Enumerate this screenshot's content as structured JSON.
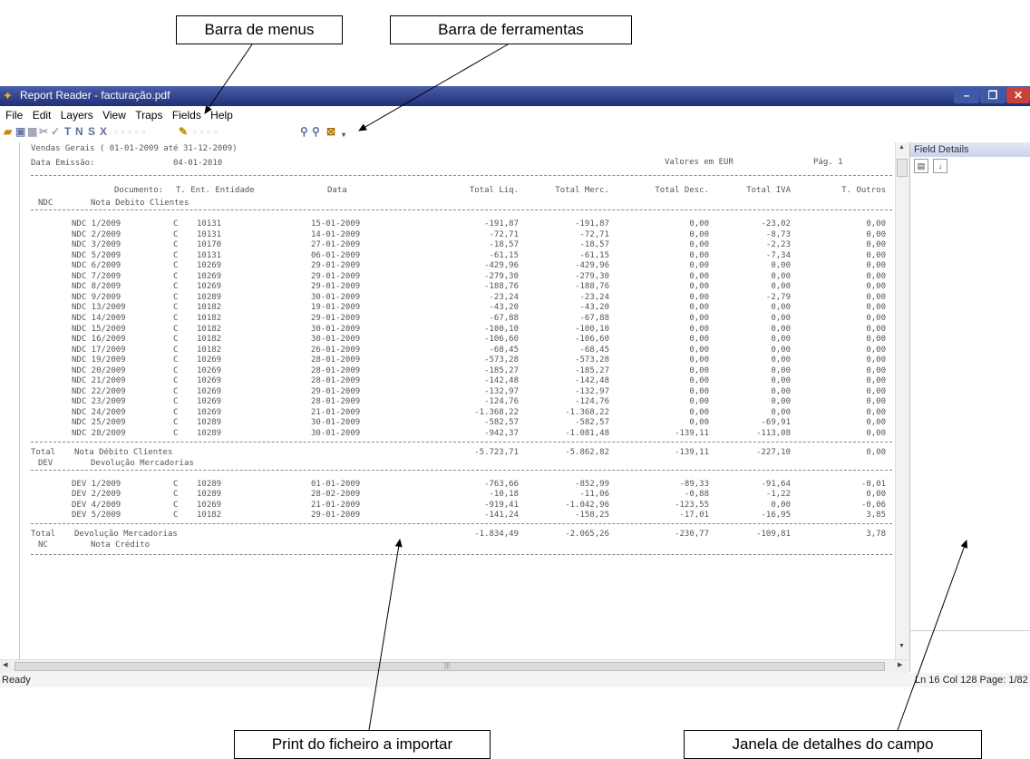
{
  "callouts": {
    "menu_bar": "Barra de menus",
    "toolbar": "Barra de ferramentas",
    "print_file": "Print do ficheiro a importar",
    "field_details_window": "Janela de detalhes do campo"
  },
  "window": {
    "title": "Report Reader - facturação.pdf",
    "controls": {
      "minimize": "–",
      "maximize": "❐",
      "close": "✕"
    }
  },
  "menu": [
    "File",
    "Edit",
    "Layers",
    "View",
    "Traps",
    "Fields",
    "Help"
  ],
  "toolbar": {
    "icons": [
      "open-icon",
      "save-icon",
      "trap-icon",
      "cut-icon",
      "check-icon",
      "text-trap-icon",
      "numeric-trap-icon",
      "string-trap-icon",
      "delete-icon",
      "zoom-in-icon",
      "zoom-out-icon",
      "fit-page-icon"
    ],
    "letters": [
      "T",
      "N",
      "S",
      "X"
    ]
  },
  "report": {
    "title": "Vendas Gerais ( 01-01-2009 até 31-12-2009)",
    "emission_label": "Data Emissão:",
    "emission_date": "04-01-2010",
    "currency_note": "Valores em EUR",
    "page_label": "Pág. 1",
    "headers": {
      "documento": "Documento:",
      "tipo_entidade": "T. Ent. Entidade",
      "data": "Data",
      "total_liq": "Total Liq.",
      "total_merc": "Total Merc.",
      "total_desc": "Total Desc.",
      "total_iva": "Total IVA",
      "total_outros": "T. Outros"
    },
    "groups": [
      {
        "code": "NDC",
        "name": "Nota Debito Clientes",
        "rows": [
          [
            "NDC 1/2009",
            "C",
            "10131",
            "15-01-2009",
            "-191,87",
            "-191,87",
            "0,00",
            "-23,02",
            "0,00"
          ],
          [
            "NDC 2/2009",
            "C",
            "10131",
            "14-01-2009",
            "-72,71",
            "-72,71",
            "0,00",
            "-8,73",
            "0,00"
          ],
          [
            "NDC 3/2009",
            "C",
            "10170",
            "27-01-2009",
            "-18,57",
            "-18,57",
            "0,00",
            "-2,23",
            "0,00"
          ],
          [
            "NDC 5/2009",
            "C",
            "10131",
            "06-01-2009",
            "-61,15",
            "-61,15",
            "0,00",
            "-7,34",
            "0,00"
          ],
          [
            "NDC 6/2009",
            "C",
            "10269",
            "29-01-2009",
            "-429,96",
            "-429,96",
            "0,00",
            "0,00",
            "0,00"
          ],
          [
            "NDC 7/2009",
            "C",
            "10269",
            "29-01-2009",
            "-279,30",
            "-279,30",
            "0,00",
            "0,00",
            "0,00"
          ],
          [
            "NDC 8/2009",
            "C",
            "10269",
            "29-01-2009",
            "-188,76",
            "-188,76",
            "0,00",
            "0,00",
            "0,00"
          ],
          [
            "NDC 9/2009",
            "C",
            "10289",
            "30-01-2009",
            "-23,24",
            "-23,24",
            "0,00",
            "-2,79",
            "0,00"
          ],
          [
            "NDC 13/2009",
            "C",
            "10182",
            "19-01-2009",
            "-43,20",
            "-43,20",
            "0,00",
            "0,00",
            "0,00"
          ],
          [
            "NDC 14/2009",
            "C",
            "10182",
            "29-01-2009",
            "-67,88",
            "-67,88",
            "0,00",
            "0,00",
            "0,00"
          ],
          [
            "NDC 15/2009",
            "C",
            "10182",
            "30-01-2009",
            "-100,10",
            "-100,10",
            "0,00",
            "0,00",
            "0,00"
          ],
          [
            "NDC 16/2009",
            "C",
            "10182",
            "30-01-2009",
            "-106,60",
            "-106,60",
            "0,00",
            "0,00",
            "0,00"
          ],
          [
            "NDC 17/2009",
            "C",
            "10182",
            "26-01-2009",
            "-68,45",
            "-68,45",
            "0,00",
            "0,00",
            "0,00"
          ],
          [
            "NDC 19/2009",
            "C",
            "10269",
            "28-01-2009",
            "-573,28",
            "-573,28",
            "0,00",
            "0,00",
            "0,00"
          ],
          [
            "NDC 20/2009",
            "C",
            "10269",
            "28-01-2009",
            "-185,27",
            "-185,27",
            "0,00",
            "0,00",
            "0,00"
          ],
          [
            "NDC 21/2009",
            "C",
            "10269",
            "28-01-2009",
            "-142,48",
            "-142,48",
            "0,00",
            "0,00",
            "0,00"
          ],
          [
            "NDC 22/2009",
            "C",
            "10269",
            "29-01-2009",
            "-132,97",
            "-132,97",
            "0,00",
            "0,00",
            "0,00"
          ],
          [
            "NDC 23/2009",
            "C",
            "10269",
            "28-01-2009",
            "-124,76",
            "-124,76",
            "0,00",
            "0,00",
            "0,00"
          ],
          [
            "NDC 24/2009",
            "C",
            "10269",
            "21-01-2009",
            "-1.368,22",
            "-1.368,22",
            "0,00",
            "0,00",
            "0,00"
          ],
          [
            "NDC 25/2009",
            "C",
            "10289",
            "30-01-2009",
            "-582,57",
            "-582,57",
            "0,00",
            "-69,91",
            "0,00"
          ],
          [
            "NDC 28/2009",
            "C",
            "10289",
            "30-01-2009",
            "-942,37",
            "-1.081,48",
            "-139,11",
            "-113,08",
            "0,00"
          ]
        ],
        "total_label": "Total",
        "total_name": "Nota Débito Clientes",
        "totals": [
          "-5.723,71",
          "-5.862,82",
          "-139,11",
          "-227,10",
          "0,00"
        ]
      },
      {
        "code": "DEV",
        "name": "Devolução Mercadorias",
        "rows": [
          [
            "DEV 1/2009",
            "C",
            "10289",
            "01-01-2009",
            "-763,66",
            "-852,99",
            "-89,33",
            "-91,64",
            "-0,01"
          ],
          [
            "DEV 2/2009",
            "C",
            "10289",
            "28-02-2009",
            "-10,18",
            "-11,06",
            "-0,88",
            "-1,22",
            "0,00"
          ],
          [
            "DEV 4/2009",
            "C",
            "10269",
            "21-01-2009",
            "-919,41",
            "-1.042,96",
            "-123,55",
            "0,00",
            "-0,06"
          ],
          [
            "DEV 5/2009",
            "C",
            "10182",
            "29-01-2009",
            "-141,24",
            "-158,25",
            "-17,01",
            "-16,95",
            "3,85"
          ]
        ],
        "total_label": "Total",
        "total_name": "Devolução Mercadorias",
        "totals": [
          "-1.834,49",
          "-2.065,26",
          "-230,77",
          "-109,81",
          "3,78"
        ]
      },
      {
        "code": "NC",
        "name": "Nota Crédito",
        "rows": []
      }
    ]
  },
  "field_details": {
    "title": "Field Details",
    "tools": [
      "categorized-icon",
      "sort-az-icon"
    ]
  },
  "status": {
    "left": "Ready",
    "right": "Ln 16 Col 128  Page: 1/82"
  }
}
